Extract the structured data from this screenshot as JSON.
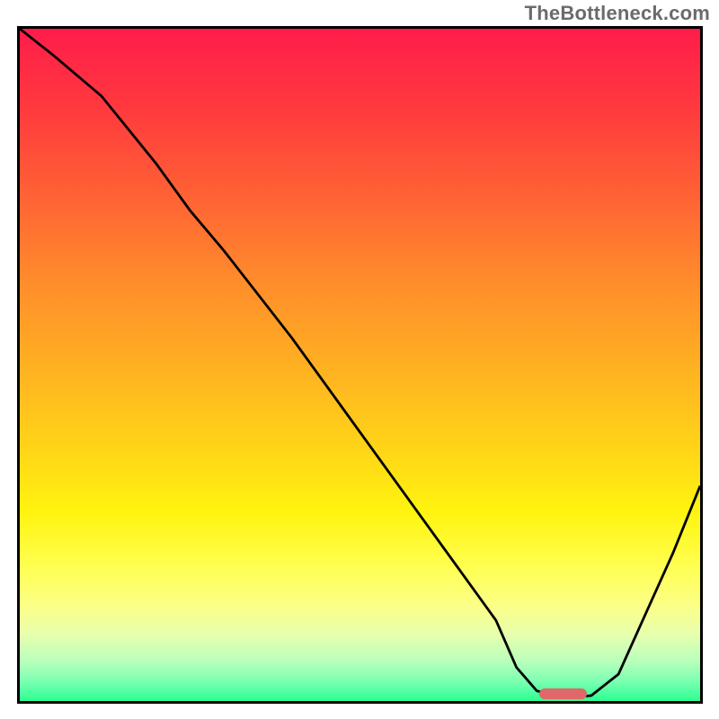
{
  "watermark": "TheBottleneck.com",
  "chart_data": {
    "type": "line",
    "title": "",
    "xlabel": "",
    "ylabel": "",
    "xlim": [
      0,
      100
    ],
    "ylim": [
      0,
      100
    ],
    "note": "Axis numeric values are estimated from pixel position; no tick labels are visible in the image.",
    "series": [
      {
        "name": "bottleneck-curve",
        "x": [
          0,
          5,
          12,
          20,
          25,
          30,
          40,
          50,
          60,
          70,
          73,
          76,
          80,
          84,
          88,
          92,
          96,
          100
        ],
        "values": [
          100,
          96,
          90,
          80,
          73,
          67,
          54,
          40,
          26,
          12,
          5,
          1.5,
          0.5,
          0.8,
          4,
          13,
          22,
          32
        ]
      }
    ],
    "gradient_stops": [
      {
        "pos": 0.0,
        "color": "#ff1c4a"
      },
      {
        "pos": 0.12,
        "color": "#ff3a3e"
      },
      {
        "pos": 0.24,
        "color": "#ff5f35"
      },
      {
        "pos": 0.37,
        "color": "#ff8a2c"
      },
      {
        "pos": 0.5,
        "color": "#ffb022"
      },
      {
        "pos": 0.62,
        "color": "#ffd318"
      },
      {
        "pos": 0.72,
        "color": "#fff40f"
      },
      {
        "pos": 0.8,
        "color": "#ffff51"
      },
      {
        "pos": 0.86,
        "color": "#fbff88"
      },
      {
        "pos": 0.9,
        "color": "#e8ffad"
      },
      {
        "pos": 0.94,
        "color": "#baffbb"
      },
      {
        "pos": 0.97,
        "color": "#7dffb2"
      },
      {
        "pos": 1.0,
        "color": "#2bff93"
      }
    ],
    "marker": {
      "x_start": 76.5,
      "x_end": 83.5,
      "y": 1.0,
      "color": "#e06868"
    }
  }
}
